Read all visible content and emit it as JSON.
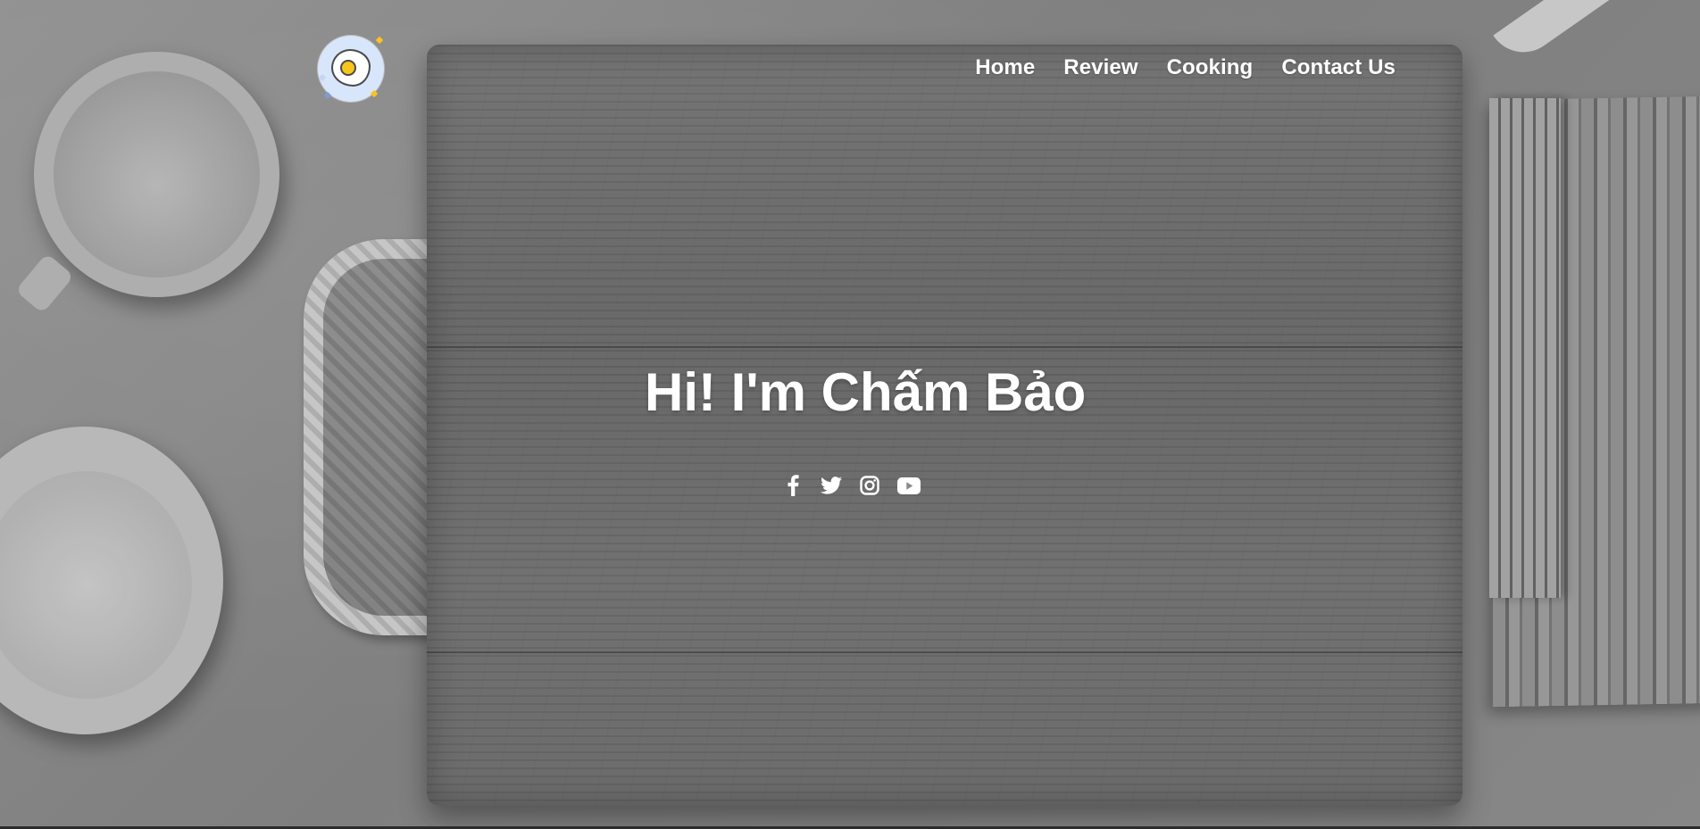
{
  "header": {
    "logo": {
      "icon": "fried-egg-icon",
      "colors": {
        "circle": "#d8e6fb",
        "yolk": "#f7c51e"
      }
    },
    "nav": [
      {
        "label": "Home"
      },
      {
        "label": "Review"
      },
      {
        "label": "Cooking"
      },
      {
        "label": "Contact Us"
      }
    ]
  },
  "hero": {
    "background_theme": "grayscale kitchen photo",
    "headline": "Hi! I'm Chấm Bảo",
    "social": [
      {
        "icon": "facebook-icon"
      },
      {
        "icon": "twitter-icon"
      },
      {
        "icon": "instagram-icon"
      },
      {
        "icon": "youtube-icon"
      }
    ]
  },
  "colors": {
    "text": "#ffffff"
  }
}
